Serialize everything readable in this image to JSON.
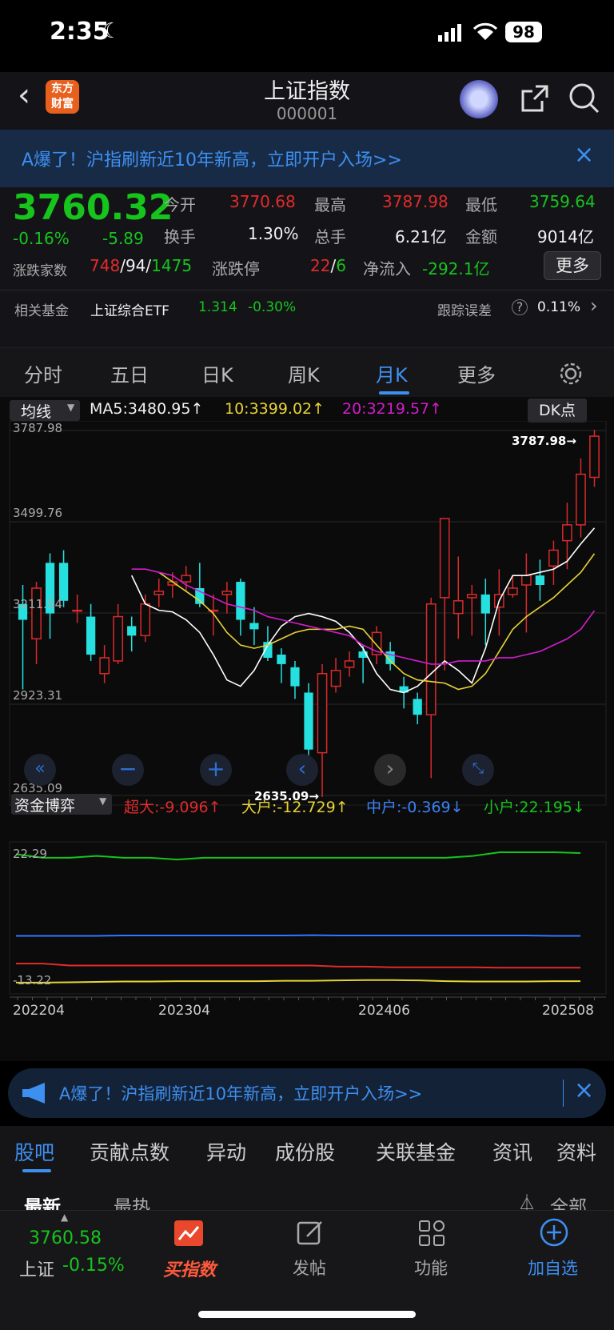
{
  "status": {
    "time": "2:35",
    "battery": "98"
  },
  "nav": {
    "title": "上证指数",
    "code": "000001",
    "logo_line1": "东方",
    "logo_line2": "财富"
  },
  "banner": {
    "text": "A爆了！沪指刷新近10年新高，立即开户入场>>"
  },
  "quote": {
    "price": "3760.32",
    "pct": "-0.16%",
    "chg": "-5.89",
    "open_label": "今开",
    "open": "3770.68",
    "high_label": "最高",
    "high": "3787.98",
    "low_label": "最低",
    "low": "3759.64",
    "turnover_label": "换手",
    "turnover": "1.30%",
    "volume_label": "总手",
    "volume": "6.21亿",
    "amount_label": "金额",
    "amount": "9014亿",
    "breadth_label": "涨跌家数",
    "up": "748",
    "flat": "94",
    "down": "1475",
    "limit_label": "涨跌停",
    "limit_up": "22",
    "limit_down": "6",
    "netflow_label": "净流入",
    "netflow": "-292.1亿",
    "more": "更多",
    "fund_label": "相关基金",
    "fund_name": "上证综合ETF",
    "fund_price": "1.314",
    "fund_pct": "-0.30%",
    "tracking_label": "跟踪误差",
    "tracking": "0.11%"
  },
  "tabs": [
    "分时",
    "五日",
    "日K",
    "周K",
    "月K",
    "更多"
  ],
  "active_tab": 4,
  "chart_header": {
    "ma_select": "均线",
    "ma5": "MA5:3480.95↑",
    "ma10": "10:3399.02↑",
    "ma20": "20:3219.57↑",
    "dk": "DK点"
  },
  "fund_header": {
    "select": "资金博弈",
    "super": "超大:-9.096↑",
    "large": "大户:-12.729↑",
    "mid": "中户:-0.369↓",
    "small": "小户:22.195↓"
  },
  "chart_data": [
    {
      "type": "candlestick",
      "y_ticks": [
        "3787.98",
        "3499.76",
        "3211.54",
        "2923.31",
        "2635.09"
      ],
      "max_label": "3787.98",
      "min_label": "2635.09",
      "x_ticks": [
        "202204",
        "202304",
        "202406",
        "202508"
      ],
      "series": [
        {
          "name": "MA5",
          "color": "#ffffff",
          "values": [
            3330,
            3240,
            3220,
            3215,
            3190,
            3150,
            3080,
            3000,
            2980,
            3030,
            3110,
            3170,
            3200,
            3210,
            3200,
            3185,
            3150,
            3100,
            3020,
            2970,
            2960,
            2980,
            3020,
            3060,
            3030,
            2990,
            3100,
            3250,
            3330,
            3330,
            3340,
            3350,
            3375,
            3430,
            3480
          ]
        },
        {
          "name": "MA10",
          "color": "#e7d334",
          "values": [
            3340,
            3310,
            3280,
            3250,
            3210,
            3150,
            3110,
            3100,
            3110,
            3130,
            3150,
            3160,
            3160,
            3160,
            3170,
            3160,
            3110,
            3060,
            3020,
            3000,
            2995,
            2990,
            2970,
            2980,
            3020,
            3090,
            3160,
            3200,
            3230,
            3260,
            3300,
            3340,
            3399
          ]
        },
        {
          "name": "MA20",
          "color": "#d21dcb",
          "values": [
            3350,
            3350,
            3340,
            3330,
            3300,
            3280,
            3260,
            3240,
            3230,
            3220,
            3200,
            3190,
            3180,
            3170,
            3160,
            3150,
            3140,
            3110,
            3090,
            3080,
            3070,
            3060,
            3050,
            3050,
            3060,
            3060,
            3060,
            3070,
            3070,
            3080,
            3090,
            3110,
            3130,
            3160,
            3219
          ]
        }
      ],
      "candles": [
        [
          3240,
          3190,
          3300,
          2970
        ],
        [
          3130,
          3290,
          3310,
          3050
        ],
        [
          3370,
          3210,
          3400,
          3130
        ],
        [
          3370,
          3250,
          3410,
          3230
        ],
        [
          3220,
          3220,
          3270,
          3180
        ],
        [
          3200,
          3080,
          3240,
          3060
        ],
        [
          3020,
          3070,
          3110,
          2990
        ],
        [
          3060,
          3200,
          3240,
          3050
        ],
        [
          3170,
          3140,
          3200,
          3090
        ],
        [
          3140,
          3240,
          3270,
          3120
        ],
        [
          3270,
          3280,
          3320,
          3230
        ],
        [
          3300,
          3310,
          3340,
          3260
        ],
        [
          3310,
          3330,
          3360,
          3280
        ],
        [
          3290,
          3240,
          3370,
          3230
        ],
        [
          3220,
          3220,
          3270,
          3140
        ],
        [
          3270,
          3280,
          3310,
          3210
        ],
        [
          3310,
          3190,
          3320,
          3140
        ],
        [
          3180,
          3160,
          3230,
          3110
        ],
        [
          3120,
          3070,
          3170,
          3060
        ],
        [
          3080,
          3050,
          3100,
          2990
        ],
        [
          3040,
          2980,
          3060,
          2940
        ],
        [
          2960,
          2780,
          2990,
          2700
        ],
        [
          2770,
          3020,
          3050,
          2630
        ],
        [
          2980,
          3030,
          3070,
          2960
        ],
        [
          3040,
          3060,
          3090,
          3010
        ],
        [
          3090,
          3070,
          3110,
          2990
        ],
        [
          3080,
          3150,
          3170,
          3050
        ],
        [
          3090,
          3050,
          3120,
          3030
        ],
        [
          2980,
          2960,
          3010,
          2910
        ],
        [
          2940,
          2890,
          2960,
          2860
        ],
        [
          2890,
          3240,
          3260,
          2690
        ],
        [
          3260,
          3510,
          3510,
          3030
        ],
        [
          3210,
          3250,
          3390,
          3130
        ],
        [
          3260,
          3270,
          3300,
          3140
        ],
        [
          3270,
          3210,
          3320,
          3110
        ],
        [
          3230,
          3270,
          3350,
          3140
        ],
        [
          3270,
          3290,
          3330,
          3260
        ],
        [
          3300,
          3330,
          3400,
          3150
        ],
        [
          3330,
          3300,
          3380,
          3250
        ],
        [
          3360,
          3410,
          3440,
          3300
        ],
        [
          3440,
          3490,
          3560,
          3350
        ],
        [
          3490,
          3650,
          3700,
          3450
        ],
        [
          3640,
          3770,
          3790,
          3610
        ]
      ]
    },
    {
      "type": "line",
      "y_ticks": [
        "22.29",
        "-13.22"
      ],
      "series": [
        {
          "name": "小户",
          "color": "#16c41c",
          "values": [
            22,
            21,
            21,
            21.5,
            21,
            21,
            20.5,
            21,
            21,
            21,
            21,
            21,
            21,
            21,
            21,
            21,
            21,
            21.5,
            22.5,
            22.5,
            22.5,
            22.29
          ]
        },
        {
          "name": "中户",
          "color": "#2f78ff",
          "values": [
            -0.4,
            -0.4,
            -0.4,
            -0.4,
            -0.3,
            -0.3,
            -0.3,
            -0.3,
            -0.3,
            -0.3,
            -0.3,
            -0.2,
            -0.3,
            -0.3,
            -0.3,
            -0.3,
            -0.3,
            -0.3,
            -0.3,
            -0.3,
            -0.4,
            -0.4
          ]
        },
        {
          "name": "超大",
          "color": "#e02b2b",
          "values": [
            -8,
            -8,
            -8.5,
            -8.5,
            -8.5,
            -8.5,
            -8.5,
            -8.5,
            -8.5,
            -8.5,
            -8.5,
            -8.5,
            -8.8,
            -8.8,
            -9,
            -9,
            -9,
            -9,
            -9.1,
            -9.1,
            -9.1,
            -9.1
          ]
        },
        {
          "name": "大户",
          "color": "#e7d334",
          "values": [
            -13.2,
            -13.2,
            -13.1,
            -13,
            -12.9,
            -12.9,
            -12.8,
            -12.8,
            -12.8,
            -12.8,
            -12.7,
            -12.7,
            -12.6,
            -12.5,
            -12.5,
            -12.6,
            -12.8,
            -12.9,
            -12.9,
            -12.9,
            -12.8,
            -12.8
          ]
        }
      ]
    }
  ],
  "bottom_tabs": [
    "股吧",
    "贡献点数",
    "异动",
    "成份股",
    "关联基金",
    "资讯",
    "资料"
  ],
  "sort": {
    "latest": "最新",
    "hot": "最热",
    "filter": "全部"
  },
  "toolbar": {
    "price": "3760.58",
    "name": "上证",
    "pct": "-0.15%",
    "buy": "买指数",
    "post": "发帖",
    "func": "功能",
    "add": "加自选"
  }
}
